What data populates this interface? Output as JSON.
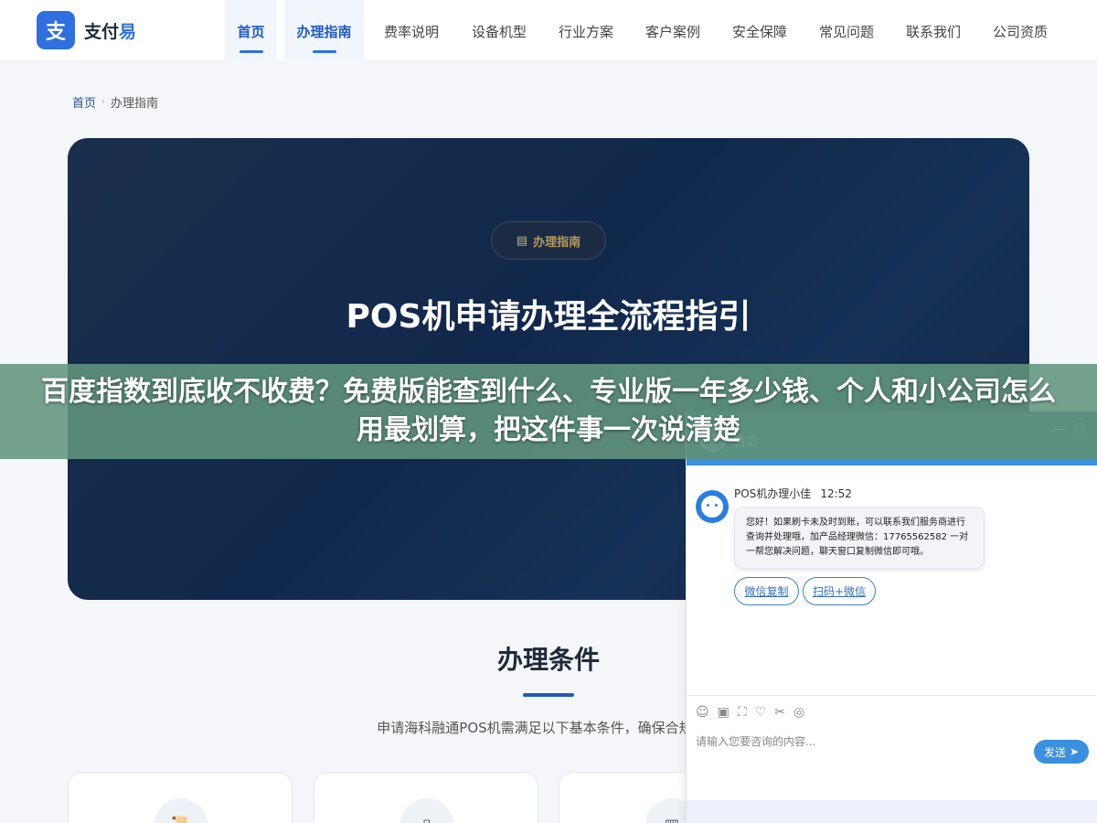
{
  "header": {
    "logo_glyph": "支",
    "logo_text_a": "支付",
    "logo_text_b": "易",
    "nav": [
      {
        "label": "首页",
        "active": true
      },
      {
        "label": "办理指南",
        "active": true
      },
      {
        "label": "费率说明"
      },
      {
        "label": "设备机型"
      },
      {
        "label": "行业方案"
      },
      {
        "label": "客户案例"
      },
      {
        "label": "安全保障"
      },
      {
        "label": "常见问题"
      },
      {
        "label": "联系我们"
      },
      {
        "label": "公司资质"
      }
    ]
  },
  "breadcrumb": {
    "home": "首页",
    "current": "办理指南"
  },
  "hero": {
    "badge": "办理指南",
    "badge_icon": "clipboard-icon",
    "title": "POS机申请办理全流程指引"
  },
  "banner": {
    "text": "百度指数到底收不收费？免费版能查到什么、专业版一年多少钱、个人和小公司怎么用最划算，把这件事一次说清楚"
  },
  "section": {
    "title": "办理条件",
    "desc": "申请海科融通POS机需满足以下基本条件，确保合规经营"
  },
  "chat": {
    "header_name": "售后",
    "header_min": "—",
    "header_max": "☐",
    "agent_name": "POS机办理小佳",
    "time": "12:52",
    "message": "您好！如果刷卡未及时到账，可以联系我们服务商进行查询并处理哦，加产品经理微信：17765562582 一对一帮您解决问题，聊天窗口复制微信即可哦。",
    "buttons": [
      "微信复制",
      "扫码+微信"
    ],
    "tools": [
      "☺",
      "▣",
      "⛶",
      "♡",
      "✂",
      "◎"
    ],
    "input_placeholder": "请输入您要咨询的内容...",
    "send": "发送"
  },
  "colors": {
    "brand": "#2f6fdf",
    "hero_bg": "#10284b",
    "banner": "#62967e",
    "chat_accent": "#3a8fde"
  }
}
